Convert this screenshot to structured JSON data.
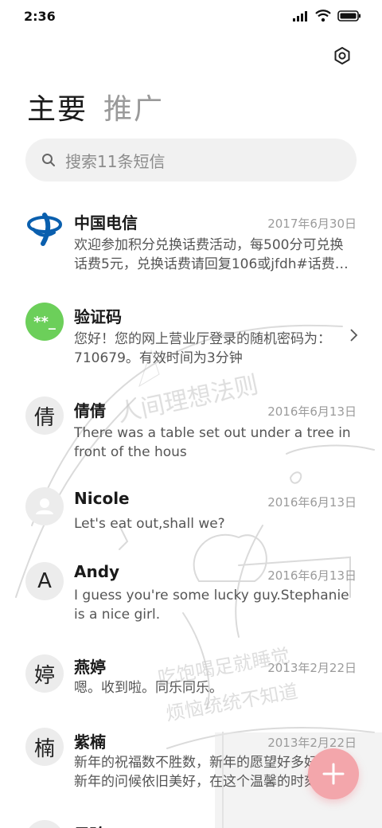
{
  "status_bar": {
    "time": "2:36"
  },
  "tabs": [
    {
      "label": "主要",
      "active": true
    },
    {
      "label": "推广",
      "active": false
    }
  ],
  "search": {
    "placeholder": "搜索11条短信"
  },
  "messages": [
    {
      "name": "中国电信",
      "date": "2017年6月30日",
      "preview": "欢迎参加积分兑换话费活动，每500分可兑换话费5元，兑换话费请回复106或jfdh#话费…",
      "avatar": "telecom-logo-icon"
    },
    {
      "name": "验证码",
      "date": "",
      "preview": "您好！您的网上营业厅登录的随机密码为：710679。有效时间为3分钟",
      "avatar_text": "**_",
      "avatar_color": "#6ccf5a"
    },
    {
      "name": "倩倩",
      "date": "2016年6月13日",
      "preview": "There was a table set out under a tree in front of the hous",
      "avatar_text": "倩"
    },
    {
      "name": "Nicole",
      "date": "2016年6月13日",
      "preview": "Let's eat out,shall we?",
      "avatar": "person-icon"
    },
    {
      "name": "Andy",
      "date": "2016年6月13日",
      "preview": "I guess you're some lucky guy.Stephanie is a nice girl.",
      "avatar_text": "A"
    },
    {
      "name": "燕婷",
      "date": "2013年2月22日",
      "preview": "嗯。收到啦。同乐同乐。",
      "avatar_text": "婷"
    },
    {
      "name": "紫楠",
      "date": "2013年2月22日",
      "preview": "新年的祝福数不胜数，新年的愿望好多好多，新年的问候依旧美好，在这个温馨的时刻",
      "avatar_text": "楠"
    },
    {
      "name": "子玲",
      "date": "",
      "preview": "",
      "avatar_text": ""
    }
  ],
  "background_text": {
    "line1": "人间理想法则",
    "line2": "吃饱喝足就睡觉",
    "line3": "烦恼统统不知道"
  },
  "colors": {
    "fab": "#f3a6ab",
    "verify_avatar": "#6ccf5a",
    "telecom_blue": "#0a5fae"
  }
}
